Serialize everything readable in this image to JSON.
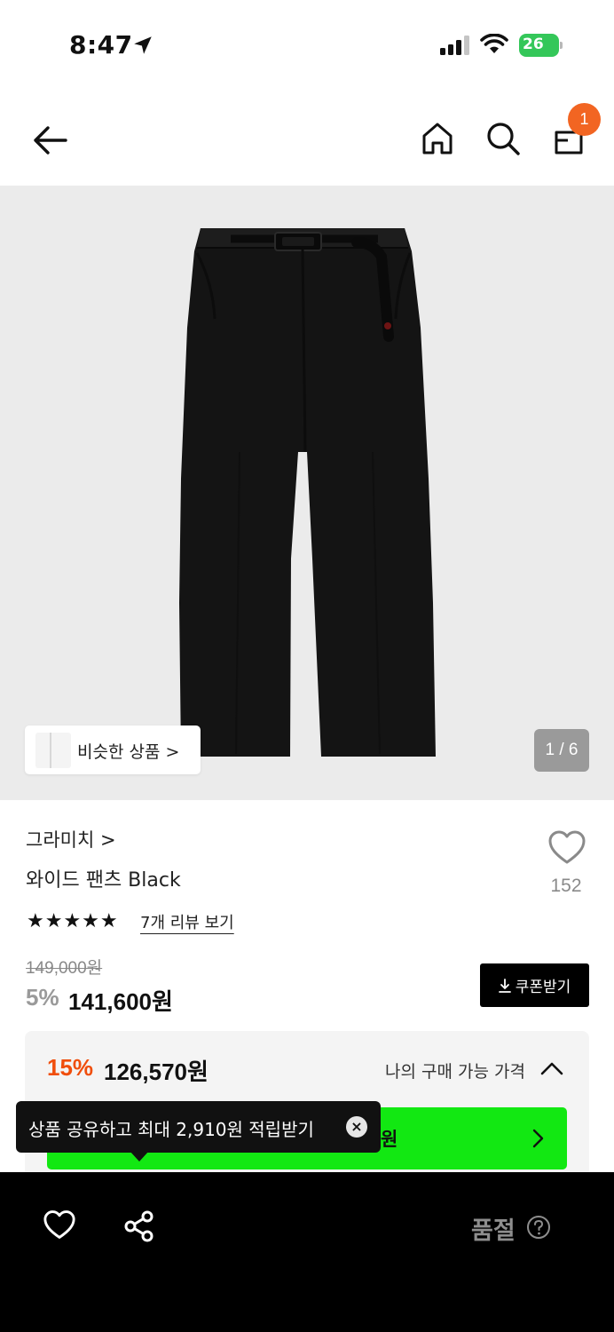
{
  "status_bar": {
    "time": "8:47",
    "battery_level": "26"
  },
  "nav": {
    "cart_badge": "1"
  },
  "hero": {
    "similar_label": "비슷한 상품 >",
    "pager": "1 / 6"
  },
  "product": {
    "brand": "그라미치 >",
    "name": "와이드 팬츠 Black",
    "likes": "152",
    "stars": "★★★★★",
    "review_link": "7개 리뷰 보기",
    "original_price": "149,000원",
    "discount_rate": "5%",
    "price": "141,600원",
    "coupon_label": "쿠폰받기"
  },
  "benefit_panel": {
    "best_rate": "15%",
    "best_price": "126,570원",
    "my_price_label": "나의 구매 가능 가격",
    "green_bar_text": "원"
  },
  "tooltip": {
    "text": "상품 공유하고 최대 2,910원 적립받기"
  },
  "bottom_bar": {
    "sold_out": "품절"
  },
  "colors": {
    "accent_orange": "#f26522",
    "discount_red": "#f04e0c",
    "green_bar": "#12e812",
    "battery_green": "#34c759"
  }
}
